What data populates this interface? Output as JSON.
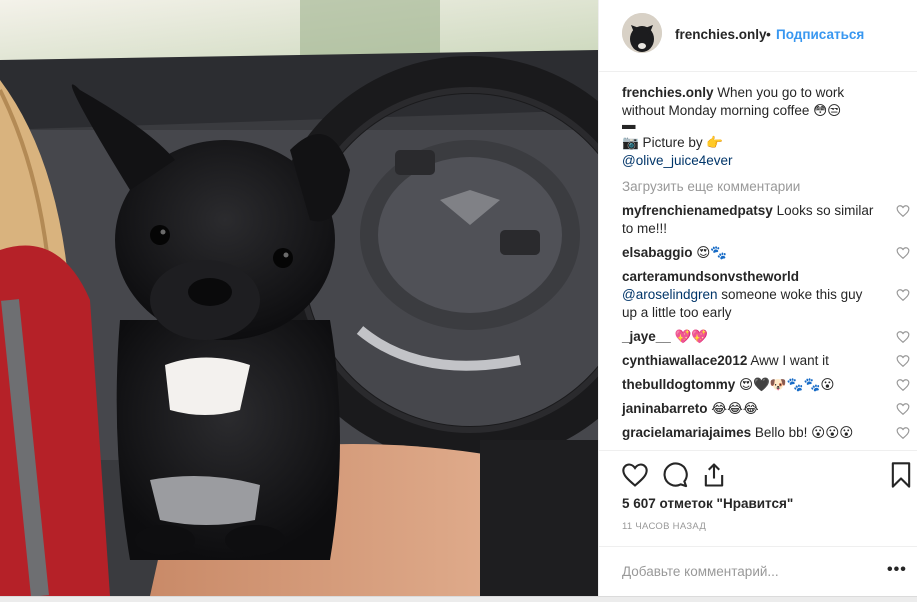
{
  "post": {
    "username": "frenchies.only",
    "dot": "•",
    "follow_label": "Подписаться",
    "caption": {
      "username": "frenchies.only",
      "line1": "When you go to work",
      "line2": "without Monday morning coffee 😳😒",
      "dash": "▬",
      "picture_by": "📷 Picture by 👉",
      "credit": "@olive_juice4ever"
    },
    "load_more": "Загрузить еще комментарии",
    "comments": [
      {
        "user": "myfrenchienamedpatsy",
        "text": "Looks so similar to me!!!"
      },
      {
        "user": "elsabaggio",
        "text": "😍🐾"
      },
      {
        "user": "carteramundsonvstheworld",
        "mention": "@aroselindgren",
        "text": "someone woke this guy up a little too early"
      },
      {
        "user": "_jaye__",
        "text": "💖💖"
      },
      {
        "user": "cynthiawallace2012",
        "text": "Aww I want it"
      },
      {
        "user": "thebulldogtommy",
        "text": "😍🖤🐶🐾🐾😮"
      },
      {
        "user": "janinabarreto",
        "text": "😂😂😂"
      },
      {
        "user": "gracielamariajaimes",
        "text": "Bello bb! 😮😮😮"
      }
    ],
    "likes": "5 607 отметок \"Нравится\"",
    "time": "11 часов назад",
    "add_comment_placeholder": "Добавьте комментарий...",
    "more_label": "•••"
  },
  "icons": {
    "like": "heart-icon",
    "comment": "comment-icon",
    "share": "share-icon",
    "save": "bookmark-icon"
  }
}
